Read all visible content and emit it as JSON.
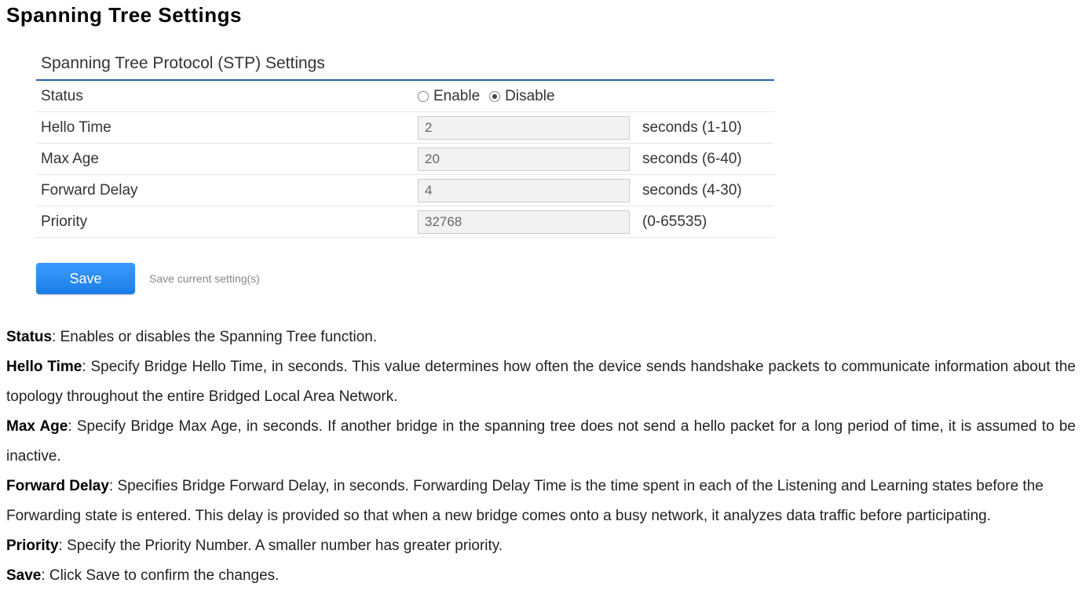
{
  "page": {
    "title": "Spanning Tree Settings"
  },
  "panel": {
    "heading": "Spanning Tree Protocol (STP) Settings",
    "rows": {
      "status": {
        "label": "Status",
        "enable_label": "Enable",
        "disable_label": "Disable",
        "selected": "disable"
      },
      "hello_time": {
        "label": "Hello Time",
        "value": "2",
        "unit": "seconds (1-10)"
      },
      "max_age": {
        "label": "Max Age",
        "value": "20",
        "unit": "seconds (6-40)"
      },
      "forward_delay": {
        "label": "Forward Delay",
        "value": "4",
        "unit": "seconds (4-30)"
      },
      "priority": {
        "label": "Priority",
        "value": "32768",
        "unit": "(0-65535)"
      }
    }
  },
  "save": {
    "button_label": "Save",
    "hint": "Save current setting(s)"
  },
  "descriptions": {
    "status_term": "Status",
    "status_text": ": Enables or disables the Spanning Tree function.",
    "hello_term": "Hello Time",
    "hello_text": ": Specify Bridge Hello Time, in seconds. This value determines how often the device sends handshake packets to communicate information about the topology throughout the entire Bridged Local Area Network.",
    "maxage_term": "Max Age",
    "maxage_text": ": Specify Bridge Max Age, in seconds. If another bridge in the spanning tree does not send a hello packet for a long period of time, it is assumed to be inactive.",
    "fwd_term": "Forward Delay",
    "fwd_text": ": Specifies Bridge Forward Delay, in seconds. Forwarding Delay Time is the time spent in each of the Listening and Learning states before the Forwarding state is entered. This delay is provided so that when a new bridge comes onto a busy network, it analyzes data traffic before participating.",
    "priority_term": "Priority",
    "priority_text": ": Specify the Priority Number. A smaller number has greater priority.",
    "save_term": "Save",
    "save_text": ": Click Save to confirm the changes."
  }
}
